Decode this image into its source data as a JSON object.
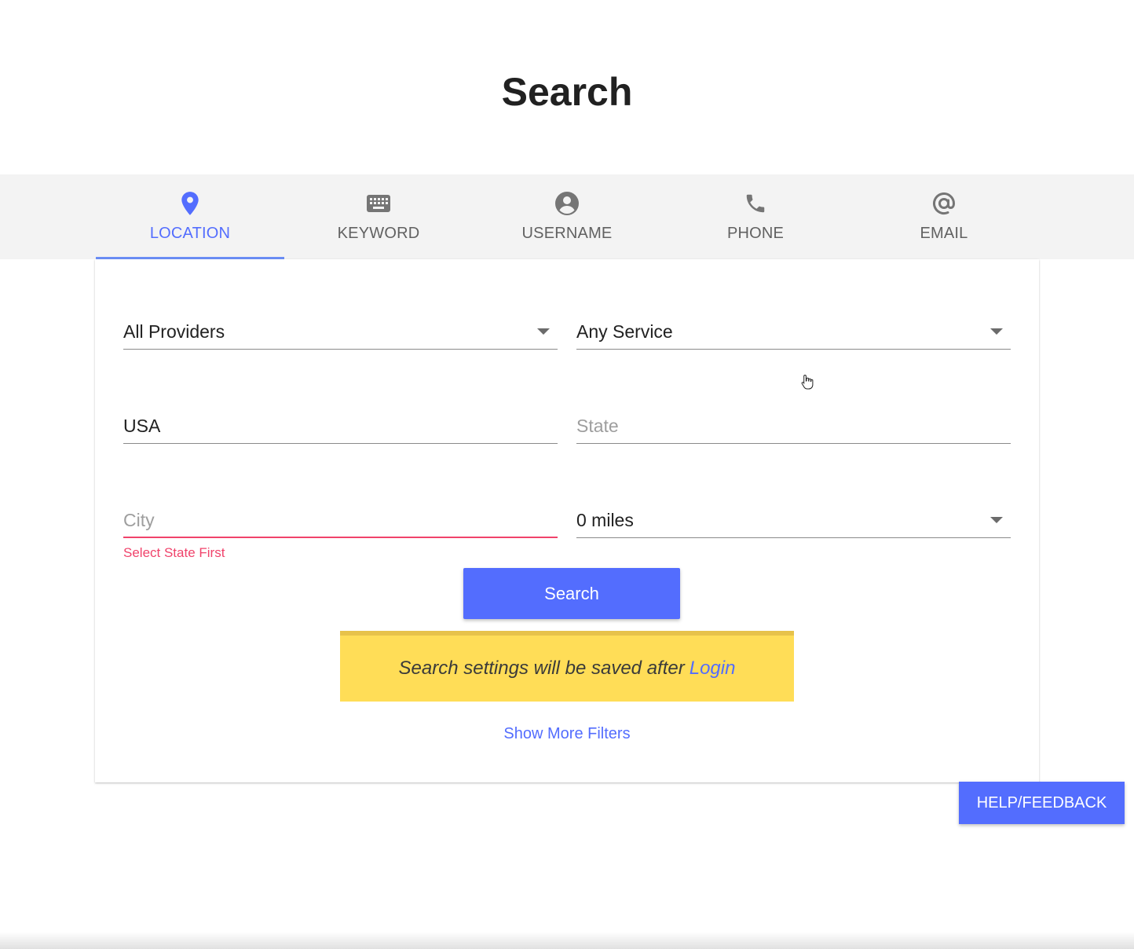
{
  "page": {
    "title": "Search"
  },
  "tabs": [
    {
      "label": "LOCATION",
      "icon": "location-pin-icon",
      "active": true
    },
    {
      "label": "KEYWORD",
      "icon": "keyboard-icon",
      "active": false
    },
    {
      "label": "USERNAME",
      "icon": "account-circle-icon",
      "active": false
    },
    {
      "label": "PHONE",
      "icon": "phone-icon",
      "active": false
    },
    {
      "label": "EMAIL",
      "icon": "at-sign-icon",
      "active": false
    }
  ],
  "form": {
    "provider": {
      "value": "All Providers"
    },
    "service": {
      "value": "Any Service"
    },
    "country": {
      "value": "USA"
    },
    "state": {
      "placeholder": "State",
      "value": ""
    },
    "city": {
      "placeholder": "City",
      "value": "",
      "error": "Select State First"
    },
    "radius": {
      "value": "0 miles"
    }
  },
  "actions": {
    "search_label": "Search",
    "more_filters_label": "Show More Filters"
  },
  "notice": {
    "text": "Search settings will be saved after",
    "link_label": "Login"
  },
  "help": {
    "label": "HELP/FEEDBACK"
  },
  "colors": {
    "accent": "#536dfe",
    "tab_bar": "#f3f3f3",
    "error": "#f0436b",
    "notice_bg": "#ffdd57"
  }
}
